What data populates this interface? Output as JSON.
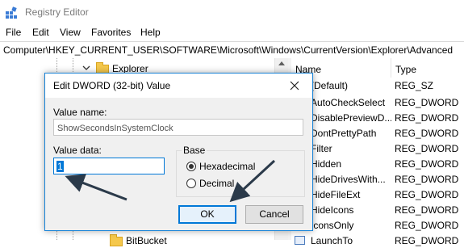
{
  "window": {
    "title": "Registry Editor"
  },
  "menu": [
    "File",
    "Edit",
    "View",
    "Favorites",
    "Help"
  ],
  "address": "Computer\\HKEY_CURRENT_USER\\SOFTWARE\\Microsoft\\Windows\\CurrentVersion\\Explorer\\Advanced",
  "tree": {
    "visible_items": [
      {
        "label": "Explorer"
      },
      {
        "label": "BitBucket"
      }
    ]
  },
  "list": {
    "headers": {
      "name": "Name",
      "type": "Type"
    },
    "rows": [
      {
        "name": "(Default)",
        "type": "REG_SZ"
      },
      {
        "name": "AutoCheckSelect",
        "type": "REG_DWORD"
      },
      {
        "name": "DisablePreviewD...",
        "type": "REG_DWORD"
      },
      {
        "name": "DontPrettyPath",
        "type": "REG_DWORD"
      },
      {
        "name": "Filter",
        "type": "REG_DWORD"
      },
      {
        "name": "Hidden",
        "type": "REG_DWORD"
      },
      {
        "name": "HideDrivesWith...",
        "type": "REG_DWORD"
      },
      {
        "name": "HideFileExt",
        "type": "REG_DWORD"
      },
      {
        "name": "HideIcons",
        "type": "REG_DWORD"
      },
      {
        "name": "IconsOnly",
        "type": "REG_DWORD"
      },
      {
        "name": "LaunchTo",
        "type": "REG_DWORD"
      }
    ]
  },
  "dialog": {
    "title": "Edit DWORD (32-bit) Value",
    "value_name_label": "Value name:",
    "value_name": "ShowSecondsInSystemClock",
    "value_data_label": "Value data:",
    "value_data": "1",
    "base_label": "Base",
    "base_options": {
      "hex": "Hexadecimal",
      "dec": "Decimal"
    },
    "base_selected": "Hexadecimal",
    "ok_label": "OK",
    "cancel_label": "Cancel"
  },
  "colors": {
    "accent": "#0078d7",
    "annotation_arrow": "#2b3a4a"
  }
}
